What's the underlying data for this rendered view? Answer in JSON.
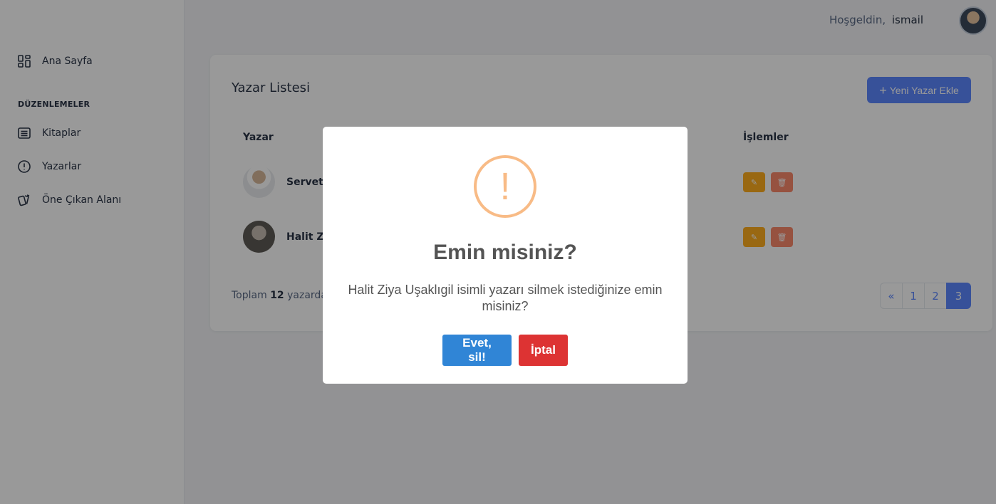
{
  "sidebar": {
    "home_label": "Ana Sayfa",
    "section_heading": "DÜZENLEMELER",
    "items": [
      {
        "label": "Kitaplar",
        "icon": "list-icon"
      },
      {
        "label": "Yazarlar",
        "icon": "alert-circle-icon"
      },
      {
        "label": "Öne Çıkan Alanı",
        "icon": "cards-icon"
      }
    ]
  },
  "header": {
    "welcome": "Hoşgeldin,",
    "username": "ismail"
  },
  "card": {
    "title": "Yazar Listesi",
    "add_button": "Yeni Yazar Ekle",
    "columns": {
      "author": "Yazar",
      "actions": "İşlemler"
    },
    "rows": [
      {
        "name": "Servet B"
      },
      {
        "name": "Halit Ziy"
      }
    ],
    "summary_prefix": "Toplam",
    "summary_count": "12",
    "summary_suffix": "yazardan",
    "pagination": [
      "«",
      "1",
      "2",
      "3"
    ],
    "active_page": "3"
  },
  "modal": {
    "icon": "!",
    "title": "Emin misiniz?",
    "text": "Halit Ziya Uşaklıgil isimli yazarı silmek istediğinize emin misiniz?",
    "confirm": "Evet, sil!",
    "cancel": "İptal"
  },
  "colors": {
    "primary": "#5d87ff",
    "warning": "#ffae1f",
    "danger": "#fa896b",
    "confirm": "#3085d6",
    "cancel": "#dd3333"
  }
}
